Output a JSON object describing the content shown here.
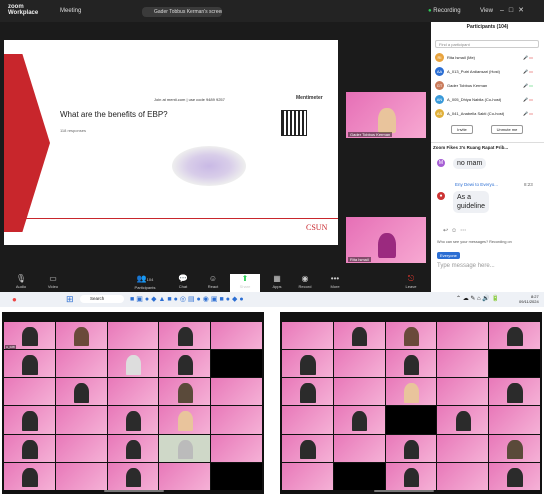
{
  "topbar": {
    "brand_line1": "zoom",
    "brand_line2": "Workplace",
    "meeting_label": "Meeting",
    "speaker_pill": "Gader Tobbus Kerman's screen",
    "recording_label": "Recording",
    "view_label": "View"
  },
  "share": {
    "code_text": "Join at menti.com | use code 9489 9257",
    "brand": "Mentimeter",
    "question": "What are the benefits of EBP?",
    "responses": "118 responses",
    "footer_brand": "CSUN"
  },
  "video_tiles": [
    {
      "label": "Gader Tobbus Kerman"
    },
    {
      "label": "Rita Ismail"
    }
  ],
  "toolbar": [
    {
      "icon": "microphone-icon",
      "label": "Audio"
    },
    {
      "icon": "video-icon",
      "label": "Video"
    },
    {
      "icon": "participants-icon",
      "label": "Participants",
      "count": "104"
    },
    {
      "icon": "chat-icon",
      "label": "Chat"
    },
    {
      "icon": "react-icon",
      "label": "React"
    },
    {
      "icon": "share-icon",
      "label": "Share"
    },
    {
      "icon": "apps-icon",
      "label": "Apps"
    },
    {
      "icon": "record-icon",
      "label": "Record"
    },
    {
      "icon": "more-icon",
      "label": "More"
    },
    {
      "icon": "leave-icon",
      "label": "Leave"
    }
  ],
  "participants": {
    "title": "Participants (104)",
    "search_placeholder": "Find a participant",
    "rows": [
      {
        "initials": "RI",
        "name": "Rita Ismail (Me)"
      },
      {
        "initials": "AA",
        "name": "A_013_Putri Ardiansari (Host)"
      },
      {
        "initials": "GT",
        "name": "Gader Tobbus Kerman"
      },
      {
        "initials": "AN",
        "name": "A_005_Dhiya Nabila (Co-host)"
      },
      {
        "initials": "AS",
        "name": "A_041_Anabella Sakti (Co-host)"
      }
    ],
    "invite_label": "Invite",
    "unmute_label": "Unmute me"
  },
  "chat": {
    "title": "Zoom Fikes 3's Ruang Rapat Prib...",
    "bubble1": "no mam",
    "sender": "Eny Dewi to Everyo...",
    "sent_time": "8:23",
    "bubble2_line1": "As a",
    "bubble2_line2": "guideline",
    "who_can_see": "Who can see your messages? Recording on",
    "audience": "Everyone",
    "input_placeholder": "Type message here..."
  },
  "taskbar": {
    "search_label": "Search",
    "time": "8:27",
    "date": "09/11/2024"
  },
  "colors": {
    "zoom_bg": "#1b1b1b",
    "accent": "#2b6ed3",
    "slide_red": "#c8262c",
    "tile_pink": "#e66fb6"
  }
}
